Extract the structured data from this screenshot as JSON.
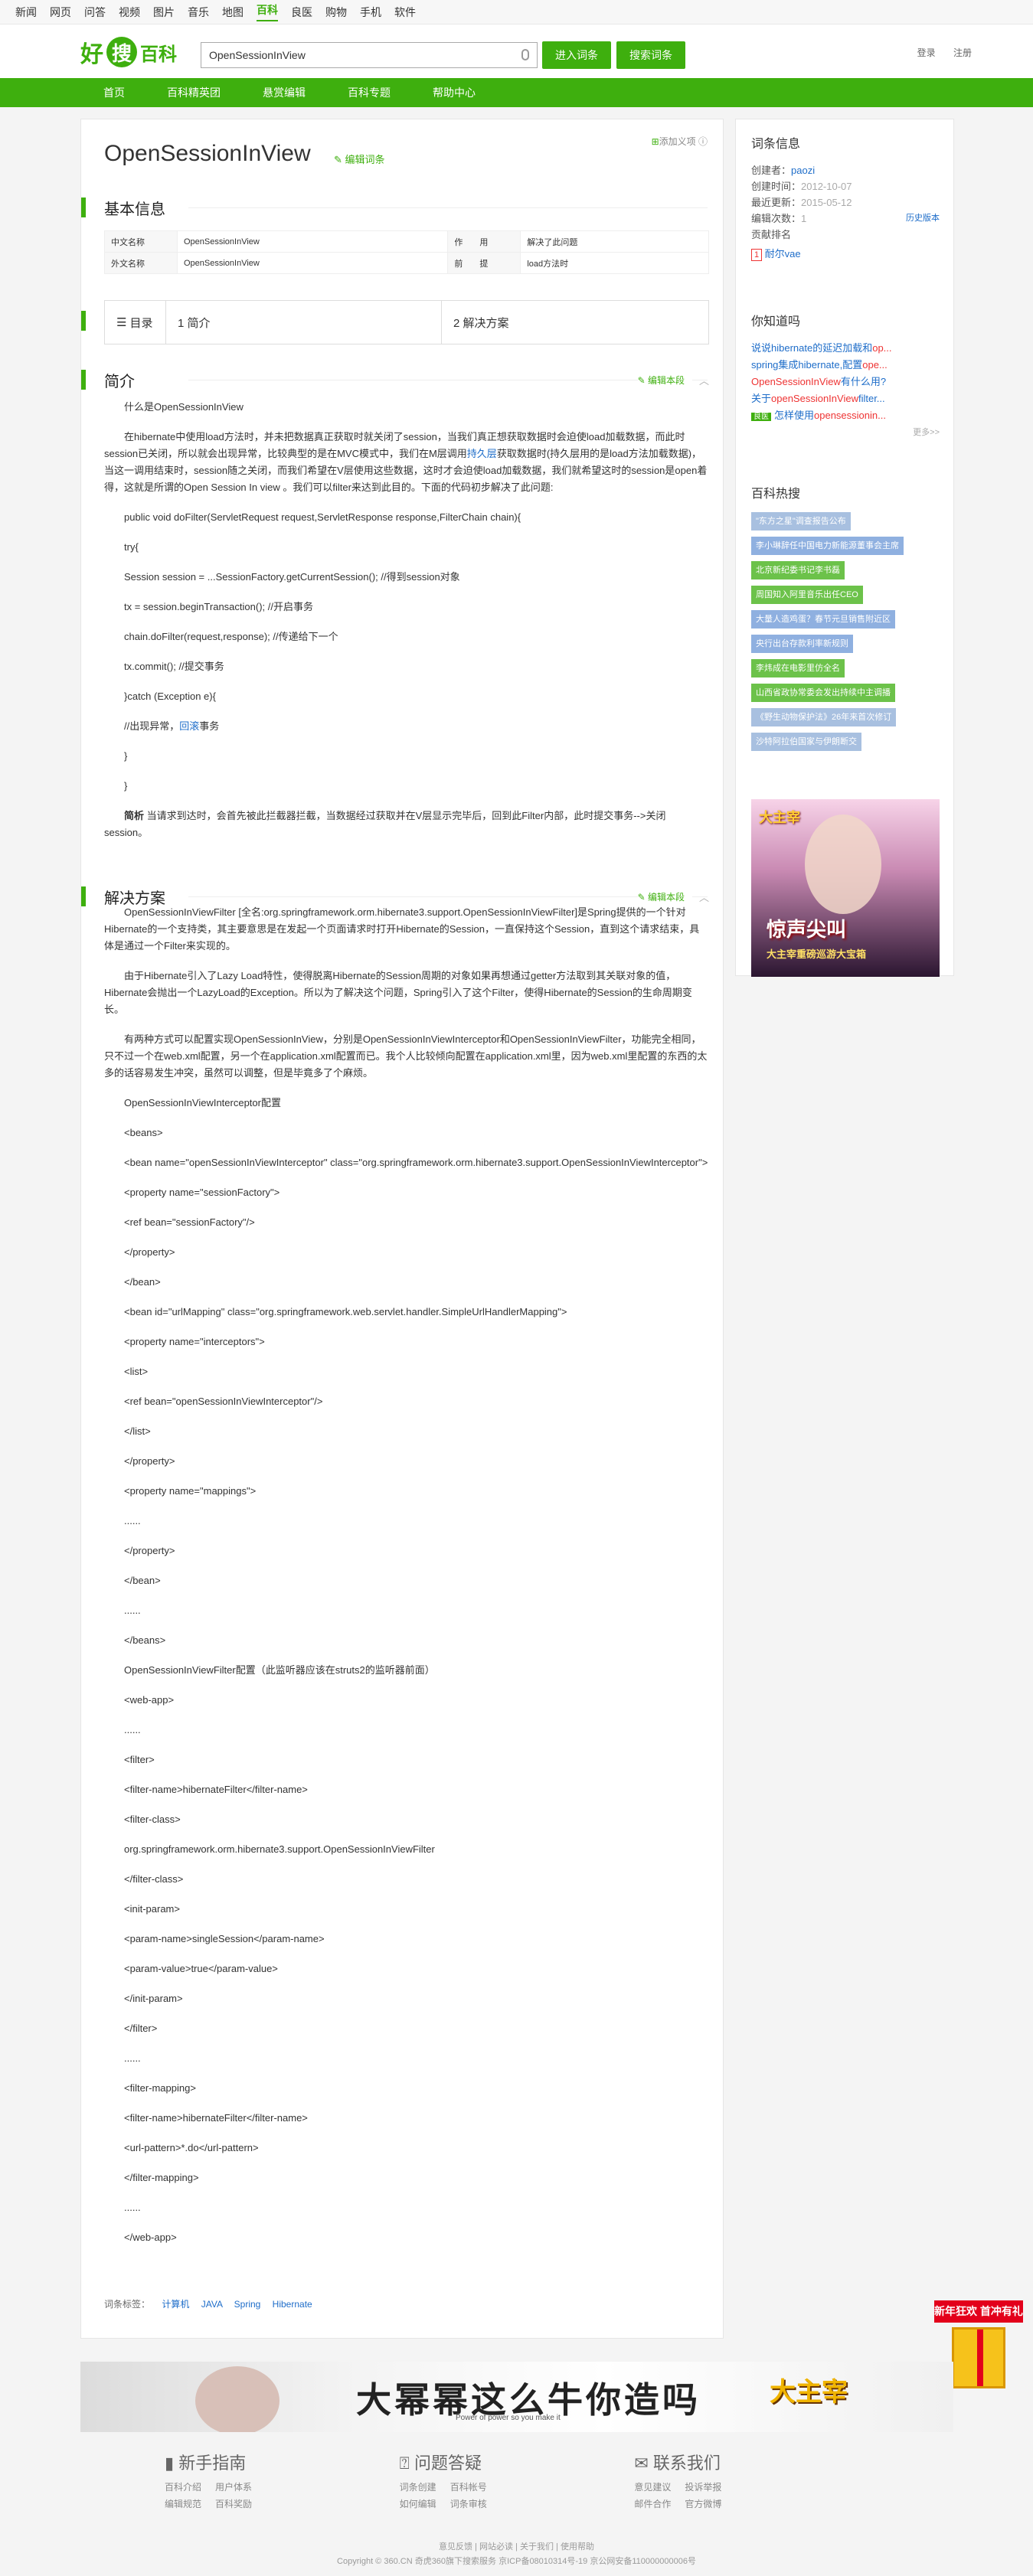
{
  "topnav": [
    "新闻",
    "网页",
    "问答",
    "视频",
    "图片",
    "音乐",
    "地图",
    "百科",
    "良医",
    "购物",
    "手机",
    "软件"
  ],
  "topnav_active": "百科",
  "logo": {
    "hao": "好",
    "sou": "搜",
    "bk": "百科"
  },
  "search": {
    "value": "OpenSessionInView",
    "enter_btn": "进入词条",
    "search_btn": "搜索词条"
  },
  "header_links": {
    "login": "登录",
    "register": "注册"
  },
  "mainnav": [
    "首页",
    "百科精英团",
    "悬赏编辑",
    "百科专题",
    "帮助中心"
  ],
  "entry": {
    "title": "OpenSessionInView",
    "edit": "编辑词条",
    "add_fav": "添加义项",
    "basic_title": "基本信息",
    "basic": [
      {
        "k1": "中文名称",
        "v1": "OpenSessionInView",
        "k2": "作　　用",
        "v2": "解决了此问题"
      },
      {
        "k1": "外文名称",
        "v1": "OpenSessionInView",
        "k2": "前　　提",
        "v2": "load方法时"
      }
    ],
    "toc": {
      "label": "目录",
      "items": [
        "1 简介",
        "2 解决方案"
      ]
    },
    "intro_title": "简介",
    "intro_edit": "编辑本段",
    "intro": [
      "什么是OpenSessionInView",
      "在hibernate中使用load方法时，并未把数据真正获取时就关闭了session，当我们真正想获取数据时会迫使load加载数据，而此时session已关闭，所以就会出现异常，比较典型的是在MVC模式中，我们在M层调用",
      "获取数据时(持久层用的是load方法加载数据)，当这一调用结束时，session随之关闭，而我们希望在V层使用这些数据，这时才会迫使load加载数据，我们就希望这时的session是open着得，这就是所谓的Open Session In view 。我们可以filter来达到此目的。下面的代码初步解决了此问题:",
      "public void doFilter(ServletRequest request,ServletResponse response,FilterChain chain){",
      "try{",
      "Session session = ...SessionFactory.getCurrentSession(); //得到session对象",
      "tx = session.beginTransaction(); //开启事务",
      "chain.doFilter(request,response); //传递给下一个",
      "tx.commit(); //提交事务",
      "}catch (Exception e){",
      "//出现异常，",
      "事务",
      "}",
      "}",
      "当请求到达时，会首先被此拦截器拦截，当数据经过获取并在V层显示完毕后，回到此Filter内部，此时提交事务-->关闭session。"
    ],
    "intro_links": {
      "persist": "持久层",
      "rollback": "回滚",
      "jianxi": "简析"
    },
    "sol_title": "解决方案",
    "sol_edit": "编辑本段",
    "solution": [
      "OpenSessionInViewFilter [全名:org.springframework.orm.hibernate3.support.OpenSessionInViewFilter]是Spring提供的一个针对Hibernate的一个支持类，其主要意思是在发起一个页面请求时打开Hibernate的Session，一直保持这个Session，直到这个请求结束，具体是通过一个Filter来实现的。",
      "由于Hibernate引入了Lazy Load特性，使得脱离Hibernate的Session周期的对象如果再想通过getter方法取到其关联对象的值，Hibernate会抛出一个LazyLoad的Exception。所以为了解决这个问题，Spring引入了这个Filter，使得Hibernate的Session的生命周期变长。",
      "有两种方式可以配置实现OpenSessionInView，分别是OpenSessionInViewInterceptor和OpenSessionInViewFilter，功能完全相同，只不过一个在web.xml配置，另一个在application.xml配置而已。我个人比较倾向配置在application.xml里，因为web.xml里配置的东西的太多的话容易发生冲突，虽然可以调整，但是毕竟多了个麻烦。",
      "OpenSessionInViewInterceptor配置",
      "<beans>",
      "<bean name=\"openSessionInViewInterceptor\" class=\"org.springframework.orm.hibernate3.support.OpenSessionInViewInterceptor\">",
      "<property name=\"sessionFactory\">",
      "<ref bean=\"sessionFactory\"/>",
      "</property>",
      "</bean>",
      "<bean id=\"urlMapping\" class=\"org.springframework.web.servlet.handler.SimpleUrlHandlerMapping\">",
      "<property name=\"interceptors\">",
      "<list>",
      "<ref bean=\"openSessionInViewInterceptor\"/>",
      "</list>",
      "</property>",
      "<property name=\"mappings\">",
      "......",
      "</property>",
      "</bean>",
      "......",
      "</beans>",
      "OpenSessionInViewFilter配置（此监听器应该在struts2的监听器前面）",
      "<web-app>",
      "......",
      "<filter>",
      "<filter-name>hibernateFilter</filter-name>",
      "<filter-class>",
      "org.springframework.orm.hibernate3.support.OpenSessionInViewFilter",
      "</filter-class>",
      "<init-param>",
      "<param-name>singleSession</param-name>",
      "<param-value>true</param-value>",
      "</init-param>",
      "</filter>",
      "......",
      "<filter-mapping>",
      "<filter-name>hibernateFilter</filter-name>",
      "<url-pattern>*.do</url-pattern>",
      "</filter-mapping>",
      "......",
      "</web-app>"
    ],
    "tags_label": "词条标签：",
    "tags": [
      "计算机",
      "JAVA",
      "Spring",
      "Hibernate"
    ]
  },
  "sidebar": {
    "info_title": "词条信息",
    "creator_label": "创建者：",
    "creator": "paozi",
    "created_label": "创建时间：",
    "created": "2012-10-07",
    "updated_label": "最近更新：",
    "updated": "2015-05-12",
    "edits_label": "编辑次数：",
    "edits": "1",
    "history": "历史版本",
    "contrib_label": "贡献排名",
    "contrib_rank": "1",
    "contrib_user": "耐尔vae",
    "know_title": "你知道吗",
    "know": [
      {
        "a": "说说hibernate的延迟加载和",
        "r": "op..."
      },
      {
        "a": "spring集成hibernate,配置",
        "r": "ope..."
      },
      {
        "a": "",
        "r": "OpenSessionInView",
        "b": "有什么用?"
      },
      {
        "a": "关于",
        "r": "openSessionInView",
        "b": "filter..."
      },
      {
        "badge": "良医",
        "a": "怎样使用",
        "r": "opensessionin..."
      }
    ],
    "more": "更多>>",
    "hot_title": "百科热搜",
    "hot": [
      "\"东方之星\"调查报告公布",
      "李小琳辞任中国电力新能源董事会主席",
      "北京新纪委书记李书磊",
      "周国知入阿里音乐出任CEO",
      "大量人造鸡蛋？春节元旦销售附近区",
      "央行出台存款利率新规则",
      "李炜成在电影里仿全名",
      "山西省政协常委会发出持续中主调播",
      "《野生动物保护法》26年来首次修订",
      "沙特阿拉伯国家与伊朗断交"
    ],
    "ad": {
      "logo": "大主宰",
      "big": "惊声尖叫",
      "small": "大主宰重磅巡游大宝箱"
    }
  },
  "banner": {
    "slogan": "大幂幂这么牛你造吗",
    "sub": "Power of power so you make it",
    "logo": "大主宰"
  },
  "gift": "新年狂欢 首冲有礼",
  "footer": {
    "cols": [
      {
        "title": "新手指南",
        "links": [
          "百科介绍",
          "用户体系",
          "编辑规范",
          "百科奖励"
        ]
      },
      {
        "title": "问题答疑",
        "links": [
          "词条创建",
          "百科帐号",
          "如何编辑",
          "词条审核"
        ]
      },
      {
        "title": "联系我们",
        "links": [
          "意见建议",
          "投诉举报",
          "邮件合作",
          "官方微博"
        ]
      }
    ],
    "line1": "意见反馈 | 网站必读 | 关于我们 | 使用帮助",
    "line2": "Copyright © 360.CN 奇虎360旗下搜索服务 京ICP备08010314号-19 京公网安备110000000006号"
  }
}
